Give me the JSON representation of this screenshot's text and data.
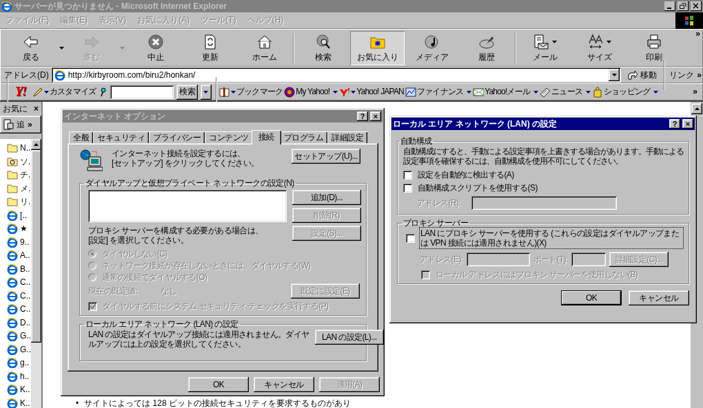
{
  "window": {
    "title": "サーバーが見つかりません - Microsoft Internet Explorer",
    "active": false
  },
  "menu": [
    {
      "label": "ファイル(F)",
      "disabled": true
    },
    {
      "label": "編集(E)",
      "disabled": true
    },
    {
      "label": "表示(V)",
      "disabled": true
    },
    {
      "label": "お気に入り(A)",
      "disabled": true
    },
    {
      "label": "ツール(T)",
      "disabled": true
    },
    {
      "label": "ヘルプ(H)",
      "disabled": true
    }
  ],
  "toolbar": [
    {
      "kind": "button",
      "label": "戻る",
      "dropdown": true,
      "disabled": false,
      "selected": false
    },
    {
      "kind": "button",
      "label": "進む",
      "dropdown": true,
      "disabled": true,
      "selected": false
    },
    {
      "kind": "button",
      "label": "中止",
      "dropdown": false,
      "disabled": false,
      "selected": false
    },
    {
      "kind": "button",
      "label": "更新",
      "dropdown": false,
      "disabled": false,
      "selected": false
    },
    {
      "kind": "button",
      "label": "ホーム",
      "dropdown": false,
      "disabled": false,
      "selected": false
    },
    {
      "kind": "separator"
    },
    {
      "kind": "button",
      "label": "検索",
      "dropdown": false,
      "disabled": false,
      "selected": false
    },
    {
      "kind": "button",
      "label": "お気に入り",
      "dropdown": false,
      "disabled": false,
      "selected": true
    },
    {
      "kind": "button",
      "label": "メディア",
      "dropdown": false,
      "disabled": false,
      "selected": false
    },
    {
      "kind": "button",
      "label": "履歴",
      "dropdown": false,
      "disabled": false,
      "selected": false
    },
    {
      "kind": "separator"
    },
    {
      "kind": "button",
      "label": "メール",
      "dropdown": true,
      "disabled": false,
      "selected": false
    },
    {
      "kind": "button",
      "label": "サイズ",
      "dropdown": true,
      "disabled": false,
      "selected": false
    },
    {
      "kind": "button",
      "label": "印刷",
      "dropdown": false,
      "disabled": false,
      "selected": false
    }
  ],
  "toolbar_more": "»",
  "address": {
    "label": "アドレス(D)",
    "url": "http://kirbyroom.com/biru2/honkan/",
    "go": "移動",
    "links": "リンク",
    "links_more": "»"
  },
  "yahoo_bar": [
    {
      "kind": "logo",
      "label": "Y!"
    },
    {
      "kind": "menu",
      "label": "カスタマイズ"
    },
    {
      "kind": "search",
      "button": "検索"
    },
    {
      "kind": "separator"
    },
    {
      "kind": "menu",
      "label": "ブックマーク"
    },
    {
      "kind": "menu",
      "label": "My Yahoo!"
    },
    {
      "kind": "menu",
      "label": "Yahoo! JAPAN"
    },
    {
      "kind": "menu",
      "label": "ファイナンス"
    },
    {
      "kind": "menu",
      "label": "Yahoo!メール"
    },
    {
      "kind": "menu",
      "label": "ニュース"
    },
    {
      "kind": "menu",
      "label": "ショッピング"
    }
  ],
  "yahoo_more": "»",
  "favorites": {
    "title": "お気に",
    "close": "×",
    "add": "追",
    "more": "»",
    "items": [
      {
        "label": "N..",
        "kind": "folder"
      },
      {
        "label": "ソ.",
        "kind": "special"
      },
      {
        "label": "チ.",
        "kind": "folder"
      },
      {
        "label": "メ.",
        "kind": "folder"
      },
      {
        "label": "リ.",
        "kind": "folder"
      },
      {
        "label": "[..",
        "kind": "page"
      },
      {
        "label": "★",
        "kind": "page"
      },
      {
        "label": "9..",
        "kind": "page"
      },
      {
        "label": "A..",
        "kind": "page"
      },
      {
        "label": "B..",
        "kind": "page"
      },
      {
        "label": "C..",
        "kind": "page"
      },
      {
        "label": "C..",
        "kind": "page"
      },
      {
        "label": "C..",
        "kind": "page"
      },
      {
        "label": "D..",
        "kind": "page"
      },
      {
        "label": "G..",
        "kind": "page"
      },
      {
        "label": "G..",
        "kind": "page"
      },
      {
        "label": "g..",
        "kind": "page"
      },
      {
        "label": "h..",
        "kind": "page"
      },
      {
        "label": "K..",
        "kind": "page"
      },
      {
        "label": "K..",
        "kind": "page"
      }
    ]
  },
  "page": {
    "bullets": [
      {
        "marker": "•",
        "text": "サイトによっては 128 ビットの接続セキュリティを要求するものがあり"
      }
    ]
  },
  "options_dialog": {
    "title": "インターネット オプション",
    "active": false,
    "help": "?",
    "close": "×",
    "tabs": [
      {
        "label": "全般",
        "selected": false
      },
      {
        "label": "セキュリティ",
        "selected": false
      },
      {
        "label": "プライバシー",
        "selected": false
      },
      {
        "label": "コンテンツ",
        "selected": false
      },
      {
        "label": "接続",
        "selected": true
      },
      {
        "label": "プログラム",
        "selected": false
      },
      {
        "label": "詳細設定",
        "selected": false
      }
    ],
    "setup_text": [
      "インターネット接続を設定するには、",
      "[セットアップ] をクリックしてください。"
    ],
    "setup_button": "セットアップ(U)...",
    "dialup": {
      "title": "ダイヤルアップと仮想プライベート ネットワークの設定(N)",
      "buttons": [
        {
          "label": "追加(D)...",
          "disabled": false
        },
        {
          "label": "削除(R)",
          "disabled": true
        },
        {
          "label": "設定(S)...",
          "disabled": true
        }
      ],
      "proxy_text": [
        "プロキシ サーバーを構成する必要がある場合は、",
        "[設定] を選択してください。"
      ],
      "options": [
        {
          "label": "ダイヤルしない(C)",
          "selected": true,
          "disabled": true
        },
        {
          "label": "ネットワーク接続が存在しないときには、ダイヤルする(W)",
          "selected": false,
          "disabled": true
        },
        {
          "label": "通常の接続でダイヤルする(O)",
          "selected": false,
          "disabled": true
        }
      ],
      "default_label": "現在の既定値:",
      "default_value": "なし",
      "default_button": {
        "label": "既定に設定(E)",
        "disabled": true
      },
      "security_check": {
        "label": "ダイヤルする前にシステム セキュリティ チェックを実行する(P)",
        "checked": true,
        "disabled": true
      }
    },
    "lan": {
      "title": "ローカル エリア ネットワーク (LAN) の設定",
      "text": [
        "LAN の設定はダイヤルアップ接続には適用されません。ダイヤ",
        "ルアップには上の設定を選択してください。"
      ],
      "button": "LAN の設定(L)..."
    },
    "buttons": [
      {
        "label": "OK",
        "disabled": false
      },
      {
        "label": "キャンセル",
        "disabled": false
      },
      {
        "label": "適用(A)",
        "disabled": true
      }
    ]
  },
  "lan_dialog": {
    "title": "ローカル エリア ネットワーク (LAN) の設定",
    "active": true,
    "help": "?",
    "close": "×",
    "auto": {
      "title": "自動構成",
      "text": [
        "自動構成にすると、手動による設定事項を上書きする場合があります。手動による",
        "設定事項を確保するには、自動構成を使用不可にしてください。"
      ],
      "checks": [
        {
          "label": "設定を自動的に検出する(A)",
          "checked": false,
          "disabled": false
        },
        {
          "label": "自動構成スクリプトを使用する(S)",
          "checked": false,
          "disabled": false
        }
      ],
      "address": {
        "label": "アドレス(R):",
        "disabled": true
      }
    },
    "proxy": {
      "title": "プロキシ サーバー",
      "use_proxy": {
        "label": "LAN にプロキシ サーバーを使用する (これらの設定はダイヤルアップまたは VPN 接続には適用されません)(X)",
        "checked": false,
        "disabled": false,
        "focused": true
      },
      "address": {
        "label": "アドレス(E):",
        "disabled": true
      },
      "port": {
        "label": "ポート(T):",
        "disabled": true
      },
      "advanced": {
        "label": "詳細設定(C)...",
        "disabled": true
      },
      "bypass": {
        "label": "ローカル アドレスにはプロキシ サーバーを使用しない(B)",
        "checked": false,
        "disabled": true
      }
    },
    "buttons": [
      {
        "label": "OK",
        "default": true
      },
      {
        "label": "キャンセル",
        "default": false
      }
    ]
  }
}
